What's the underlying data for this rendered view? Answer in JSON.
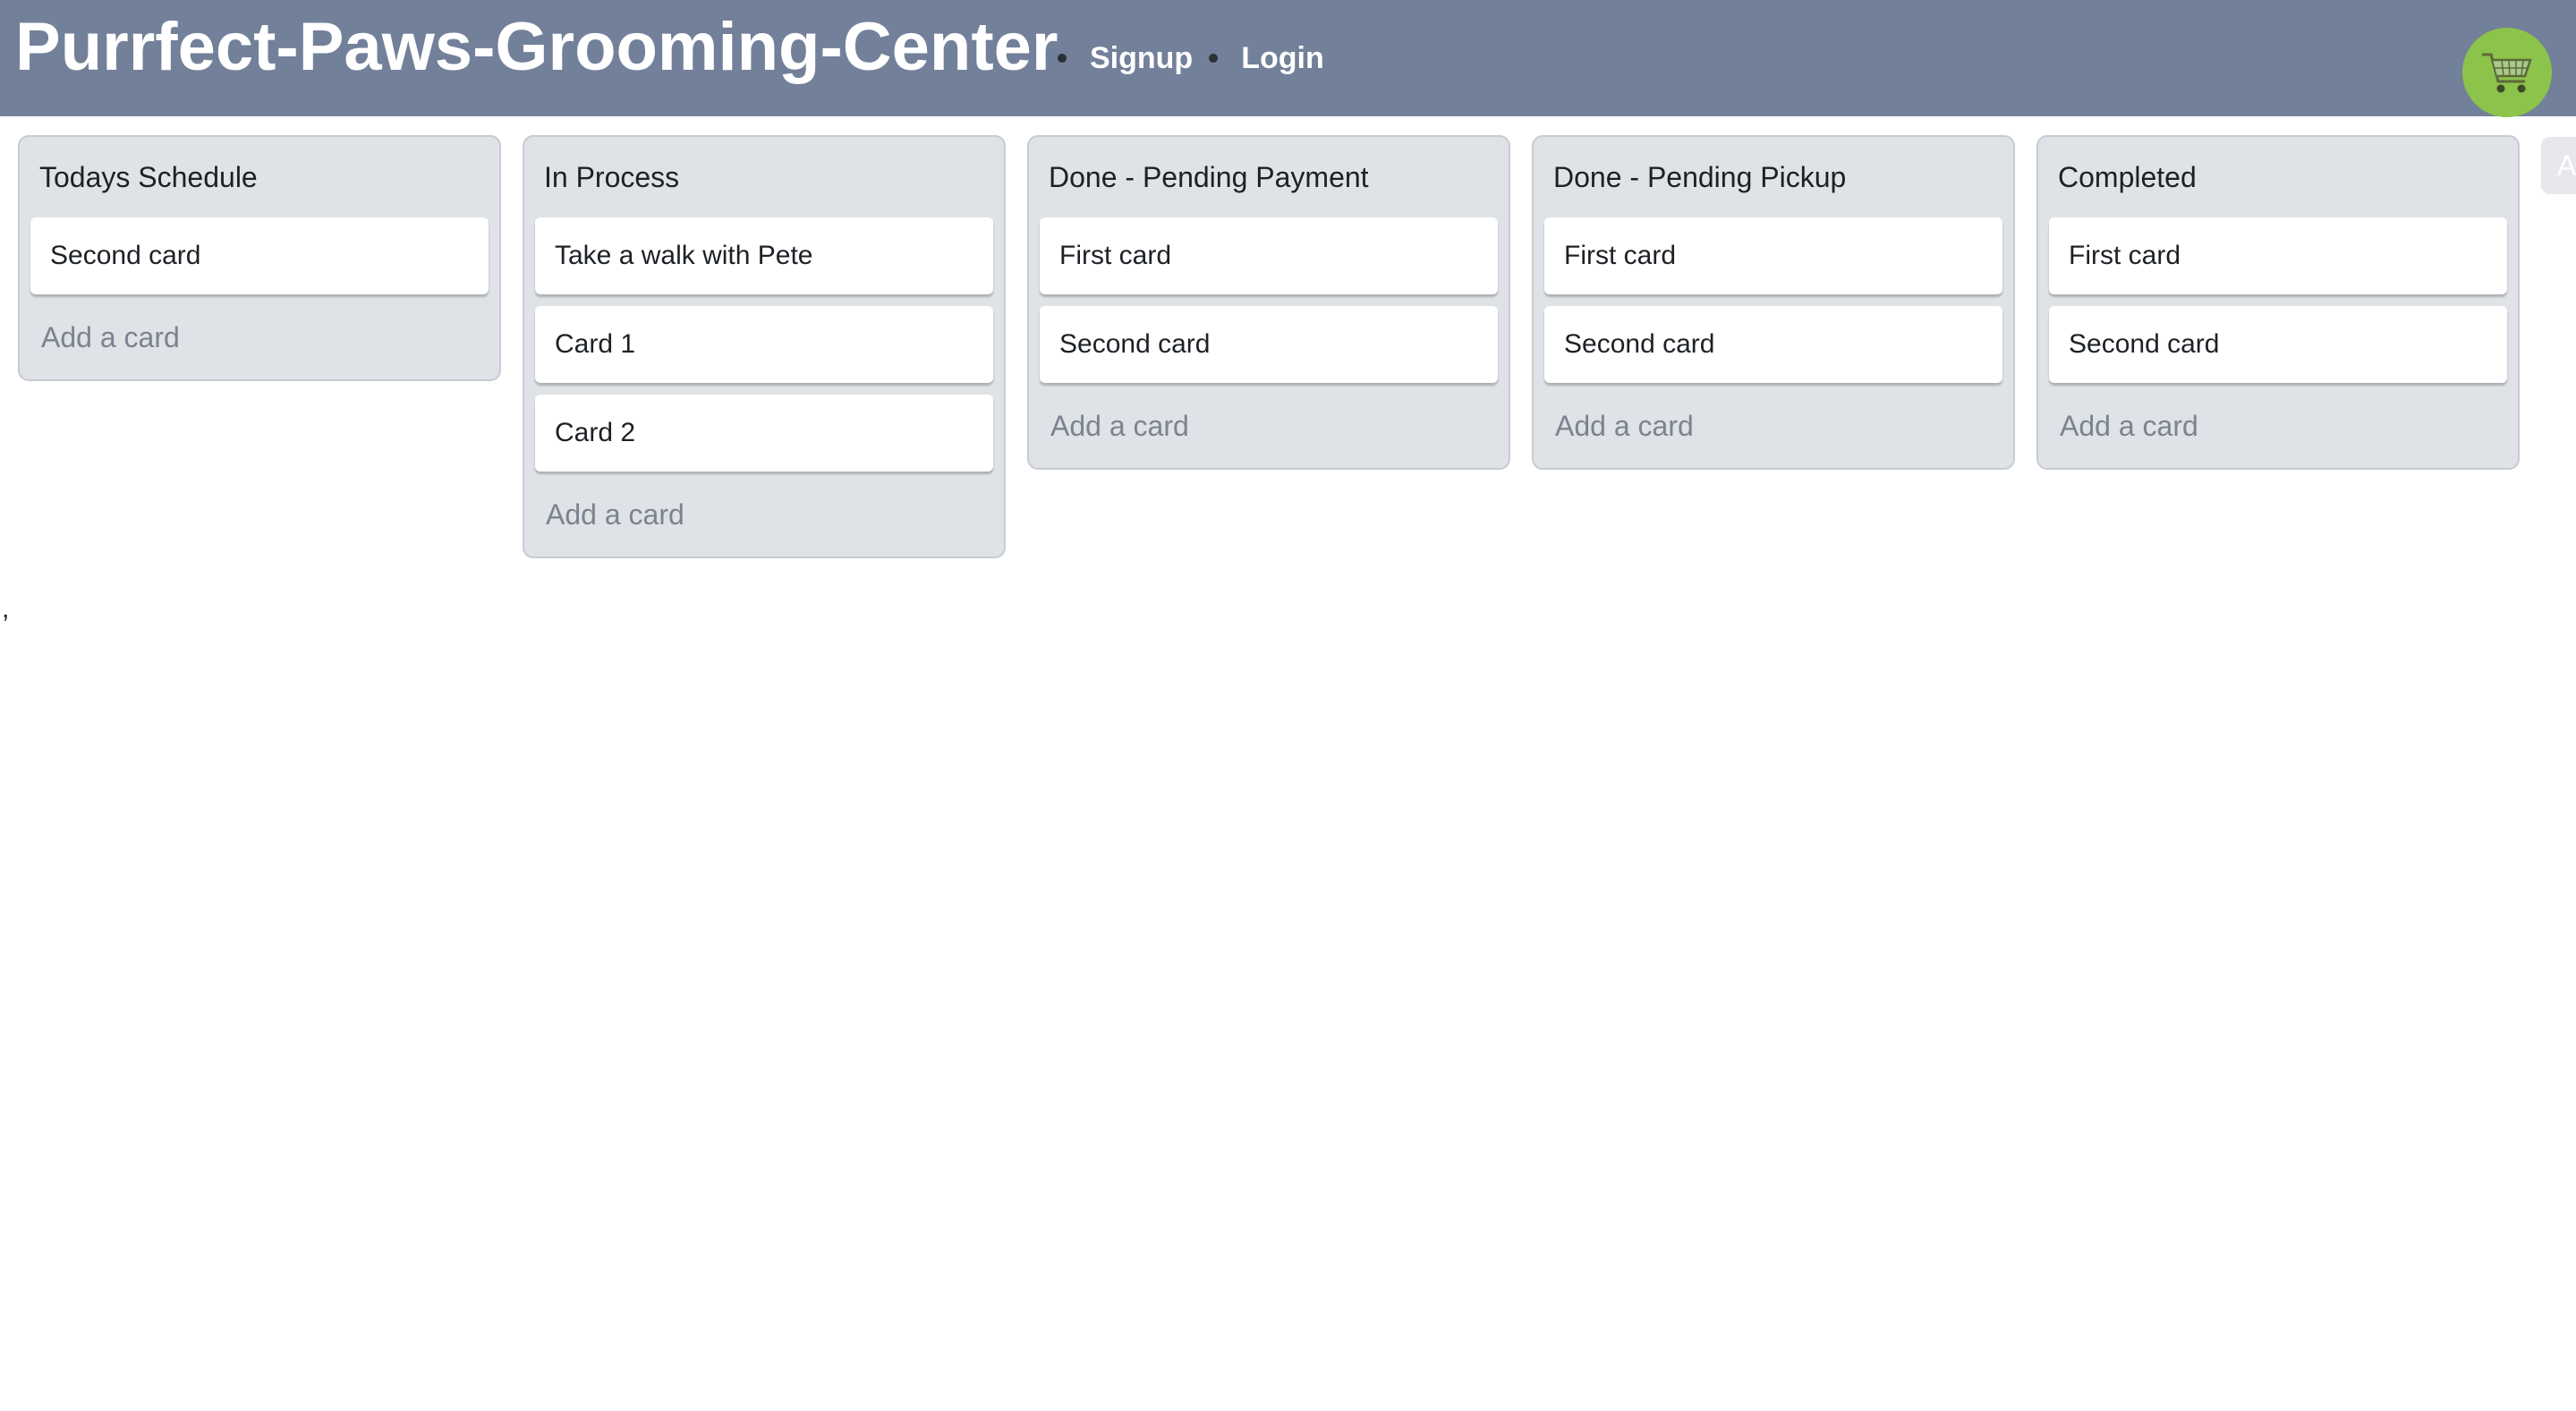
{
  "header": {
    "title": "Purrfect-Paws-Grooming-Center",
    "nav": [
      {
        "label": "Signup"
      },
      {
        "label": "Login"
      }
    ],
    "cart_icon": "shopping-cart-icon",
    "cart_color": "#8cc34a",
    "bar_color": "#73809a"
  },
  "board": {
    "lists": [
      {
        "title": "Todays Schedule",
        "cards": [
          "Second card"
        ],
        "add_label": "Add a card"
      },
      {
        "title": "In Process",
        "cards": [
          "Take a walk with Pete",
          "Card 1",
          "Card 2"
        ],
        "add_label": "Add a card"
      },
      {
        "title": "Done - Pending Payment",
        "cards": [
          "First card",
          "Second card"
        ],
        "add_label": "Add a card"
      },
      {
        "title": "Done - Pending Pickup",
        "cards": [
          "First card",
          "Second card"
        ],
        "add_label": "Add a card"
      },
      {
        "title": "Completed",
        "cards": [
          "First card",
          "Second card"
        ],
        "add_label": "Add a card"
      }
    ],
    "add_list_partial": "A"
  },
  "footer_text": ","
}
